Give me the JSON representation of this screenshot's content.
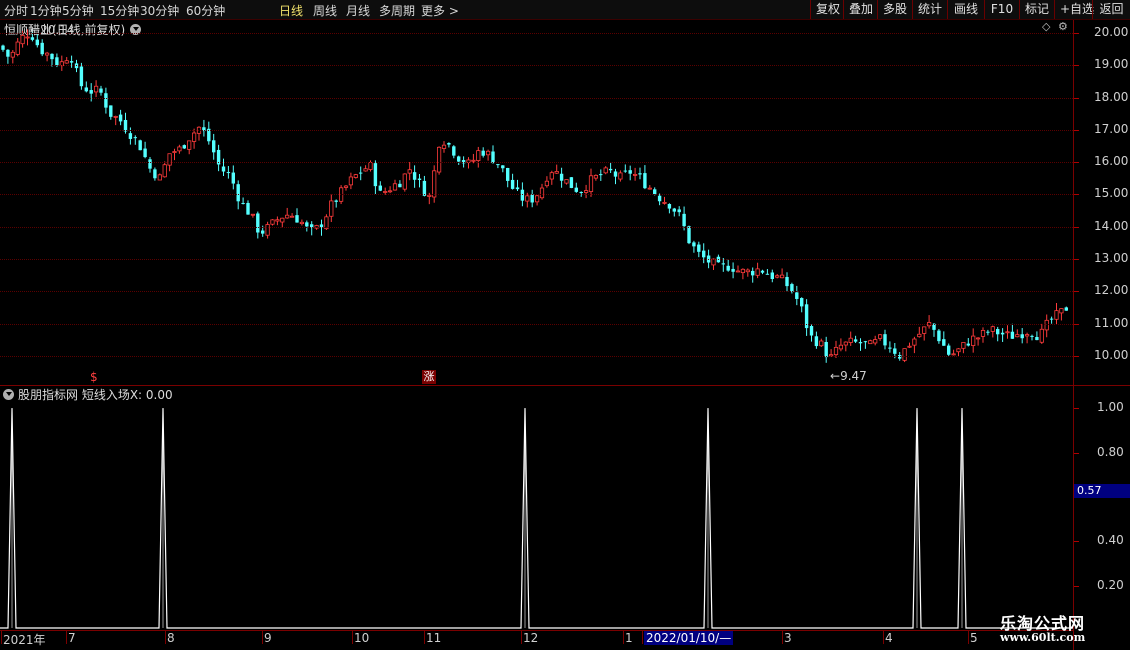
{
  "toolbar": {
    "periods": [
      {
        "label": "分时",
        "active": false
      },
      {
        "label": "1分钟",
        "active": false
      },
      {
        "label": "5分钟",
        "active": false
      },
      {
        "label": "15分钟",
        "active": false
      },
      {
        "label": "30分钟",
        "active": false
      },
      {
        "label": "60分钟",
        "active": false
      },
      {
        "label": "日线",
        "active": true
      },
      {
        "label": "周线",
        "active": false
      },
      {
        "label": "月线",
        "active": false
      },
      {
        "label": "多周期",
        "active": false
      },
      {
        "label": "更多 >",
        "active": false
      }
    ],
    "tools": [
      "复权",
      "叠加",
      "多股",
      "统计",
      "画线",
      "F10",
      "标记",
      "+自选",
      "返回"
    ]
  },
  "main_panel": {
    "title": "恒顺醋业(日线,前复权)",
    "high_label": "20.14",
    "low_label": "9.47",
    "y_ticks": [
      "20.00",
      "19.00",
      "18.00",
      "17.00",
      "16.00",
      "15.00",
      "14.00",
      "13.00",
      "12.00",
      "11.00",
      "10.00"
    ],
    "markers": [
      "$",
      "涨"
    ]
  },
  "indicator_panel": {
    "title": "股朋指标网 短线入场X: 0.00",
    "y_ticks": [
      "1.00",
      "0.80",
      "0.40",
      "0.20"
    ],
    "cursor_value": "0.57"
  },
  "x_axis": {
    "labels": [
      "2021年",
      "7",
      "8",
      "9",
      "10",
      "11",
      "12",
      "1",
      "2022/01/10/—",
      "3",
      "4",
      "5"
    ]
  },
  "watermark": {
    "line1": "乐淘公式网",
    "line2": "www.60lt.com"
  },
  "colors": {
    "up": "#ff3b3b",
    "down": "#54ffff",
    "axis": "#7a0000",
    "signal": "#ffffff",
    "cursor_bg": "#000080"
  },
  "chart_data": [
    {
      "type": "candlestick",
      "title": "恒顺醋业(日线,前复权)",
      "ylim": [
        9.1,
        20.4
      ],
      "y_ticks": [
        20,
        19,
        18,
        17,
        16,
        15,
        14,
        13,
        12,
        11,
        10
      ],
      "annotations": [
        {
          "text": "20.14",
          "value": 20.14
        },
        {
          "text": "9.47",
          "value": 9.47
        }
      ],
      "close_path": [
        [
          0,
          19.6
        ],
        [
          10,
          19.2
        ],
        [
          20,
          19.8
        ],
        [
          30,
          20.05
        ],
        [
          40,
          19.5
        ],
        [
          50,
          19.3
        ],
        [
          60,
          19.0
        ],
        [
          70,
          19.4
        ],
        [
          80,
          18.4
        ],
        [
          90,
          18.2
        ],
        [
          100,
          18.2
        ],
        [
          110,
          17.5
        ],
        [
          120,
          17.3
        ],
        [
          130,
          16.9
        ],
        [
          140,
          16.5
        ],
        [
          150,
          15.8
        ],
        [
          160,
          15.5
        ],
        [
          170,
          16.3
        ],
        [
          180,
          16.4
        ],
        [
          190,
          16.8
        ],
        [
          200,
          17.1
        ],
        [
          210,
          16.6
        ],
        [
          220,
          15.8
        ],
        [
          230,
          15.6
        ],
        [
          240,
          14.8
        ],
        [
          250,
          14.4
        ],
        [
          260,
          13.8
        ],
        [
          270,
          14.0
        ],
        [
          280,
          14.3
        ],
        [
          290,
          14.4
        ],
        [
          300,
          14.2
        ],
        [
          310,
          13.8
        ],
        [
          320,
          14.0
        ],
        [
          330,
          14.6
        ],
        [
          340,
          15.0
        ],
        [
          350,
          15.4
        ],
        [
          360,
          15.7
        ],
        [
          370,
          15.9
        ],
        [
          380,
          15.0
        ],
        [
          390,
          15.2
        ],
        [
          400,
          15.4
        ],
        [
          410,
          15.8
        ],
        [
          420,
          15.3
        ],
        [
          430,
          14.9
        ],
        [
          440,
          16.8
        ],
        [
          450,
          16.5
        ],
        [
          460,
          16.1
        ],
        [
          470,
          15.9
        ],
        [
          480,
          16.4
        ],
        [
          490,
          16.2
        ],
        [
          500,
          15.9
        ],
        [
          510,
          15.3
        ],
        [
          520,
          14.9
        ],
        [
          530,
          14.8
        ],
        [
          540,
          15.1
        ],
        [
          550,
          15.8
        ],
        [
          560,
          15.6
        ],
        [
          570,
          15.3
        ],
        [
          580,
          15.1
        ],
        [
          590,
          15.4
        ],
        [
          600,
          15.6
        ],
        [
          610,
          15.7
        ],
        [
          620,
          15.5
        ],
        [
          630,
          15.7
        ],
        [
          640,
          15.5
        ],
        [
          650,
          15.2
        ],
        [
          660,
          14.9
        ],
        [
          670,
          14.7
        ],
        [
          680,
          14.3
        ],
        [
          690,
          13.5
        ],
        [
          700,
          13.1
        ],
        [
          710,
          12.9
        ],
        [
          720,
          12.7
        ],
        [
          730,
          12.8
        ],
        [
          740,
          12.6
        ],
        [
          750,
          12.6
        ],
        [
          760,
          12.7
        ],
        [
          770,
          12.5
        ],
        [
          780,
          12.4
        ],
        [
          790,
          12.1
        ],
        [
          800,
          11.6
        ],
        [
          810,
          10.6
        ],
        [
          820,
          10.4
        ],
        [
          830,
          9.9
        ],
        [
          840,
          10.3
        ],
        [
          850,
          10.4
        ],
        [
          860,
          10.4
        ],
        [
          870,
          10.3
        ],
        [
          880,
          10.5
        ],
        [
          890,
          10.3
        ],
        [
          900,
          10.0
        ],
        [
          910,
          10.4
        ],
        [
          920,
          10.7
        ],
        [
          930,
          11.0
        ],
        [
          940,
          10.5
        ],
        [
          950,
          10.0
        ],
        [
          960,
          10.2
        ],
        [
          970,
          10.5
        ],
        [
          980,
          10.6
        ],
        [
          990,
          10.8
        ],
        [
          1000,
          10.7
        ],
        [
          1010,
          10.6
        ],
        [
          1020,
          10.7
        ],
        [
          1030,
          10.8
        ],
        [
          1040,
          10.6
        ],
        [
          1050,
          11.1
        ],
        [
          1060,
          11.3
        ],
        [
          1070,
          11.6
        ]
      ]
    },
    {
      "type": "line",
      "title": "股朋指标网 短线入场X: 0.00",
      "ylim": [
        0,
        1.1
      ],
      "y_ticks": [
        1.0,
        0.8,
        0.4,
        0.2
      ],
      "series": [
        {
          "name": "短线入场X",
          "spike_values": [
            1,
            1,
            1,
            1,
            1,
            1
          ],
          "baseline": 0
        }
      ]
    }
  ]
}
